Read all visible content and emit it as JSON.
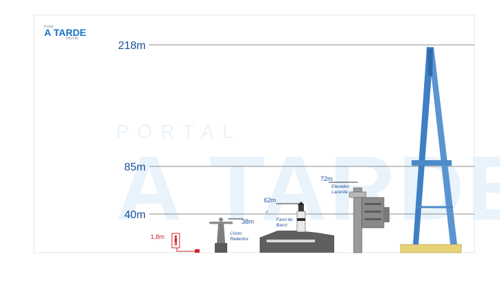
{
  "logo": {
    "text": "A TARDE",
    "small": "Portal",
    "tag": "DIGITAL"
  },
  "watermark": {
    "small": "PORTAL",
    "big": "A TARDE"
  },
  "colors": {
    "axis": "#1a4e9a",
    "red": "#d0232a",
    "bridge": "#3f7fc4",
    "grid": "#8e8e8e",
    "watermark": "#e8f3fb",
    "base": "#e7d27a"
  },
  "chart_data": {
    "type": "bar",
    "title": "",
    "xlabel": "",
    "ylabel": "",
    "ylim": [
      0,
      218
    ],
    "grid_lines": [
      218,
      85,
      40
    ],
    "tick_labels": [
      "218m",
      "85m",
      "40m"
    ],
    "categories": [
      "Pessoa",
      "Cristo Redentor",
      "Farol da Barra",
      "Elevador Lacerda",
      "Ponte"
    ],
    "values": [
      1.8,
      38,
      62,
      72,
      218
    ],
    "labels": [
      {
        "value_text": "1,8m",
        "name": ""
      },
      {
        "value_text": "38m",
        "name": "Cristo Redentor"
      },
      {
        "value_text": "62m",
        "name": "Farol do Barro"
      },
      {
        "value_text": "72m",
        "name": "Elevador Lacerda"
      },
      {
        "value_text": "",
        "name": ""
      }
    ],
    "grid": true,
    "legend": "none"
  }
}
